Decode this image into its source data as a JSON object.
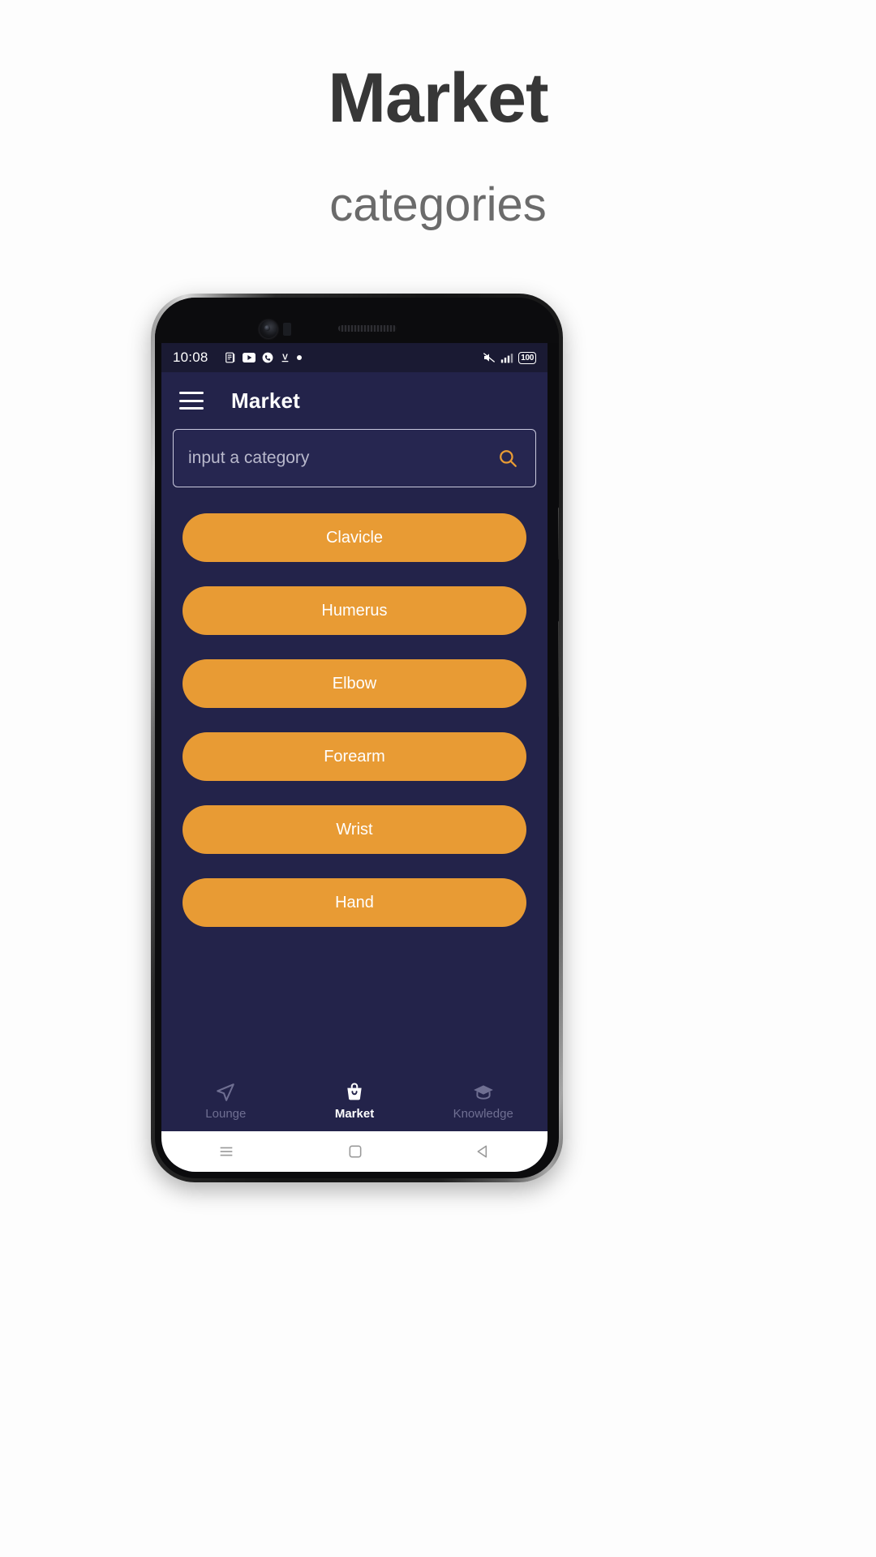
{
  "promo": {
    "headline": "Market",
    "subheadline": "categories"
  },
  "phone": {
    "statusbar": {
      "time": "10:08",
      "left_icons": [
        "document-icon",
        "youtube-icon",
        "call-icon",
        "v-app-icon",
        "dot-icon"
      ],
      "right_icons": [
        "mute-icon",
        "signal-icon",
        "battery-icon"
      ],
      "battery_level": "100"
    },
    "appbar": {
      "menu_icon": "hamburger-icon",
      "title": "Market"
    },
    "search": {
      "placeholder": "input a category",
      "value": "",
      "icon": "search-icon"
    },
    "categories": [
      {
        "label": "Clavicle"
      },
      {
        "label": "Humerus"
      },
      {
        "label": "Elbow"
      },
      {
        "label": "Forearm"
      },
      {
        "label": "Wrist"
      },
      {
        "label": "Hand"
      }
    ],
    "bottom_nav": [
      {
        "label": "Lounge",
        "icon": "send-icon",
        "active": false
      },
      {
        "label": "Market",
        "icon": "basket-icon",
        "active": true
      },
      {
        "label": "Knowledge",
        "icon": "graduation-cap-icon",
        "active": false
      }
    ],
    "system_nav": [
      "recents-icon",
      "home-icon",
      "back-icon"
    ]
  },
  "colors": {
    "accent_orange": "#e89b34",
    "screen_bg": "#23234a",
    "statusbar_bg": "#1a1a33",
    "title_text": "#373737",
    "subtitle_text": "#6b6b6b"
  }
}
